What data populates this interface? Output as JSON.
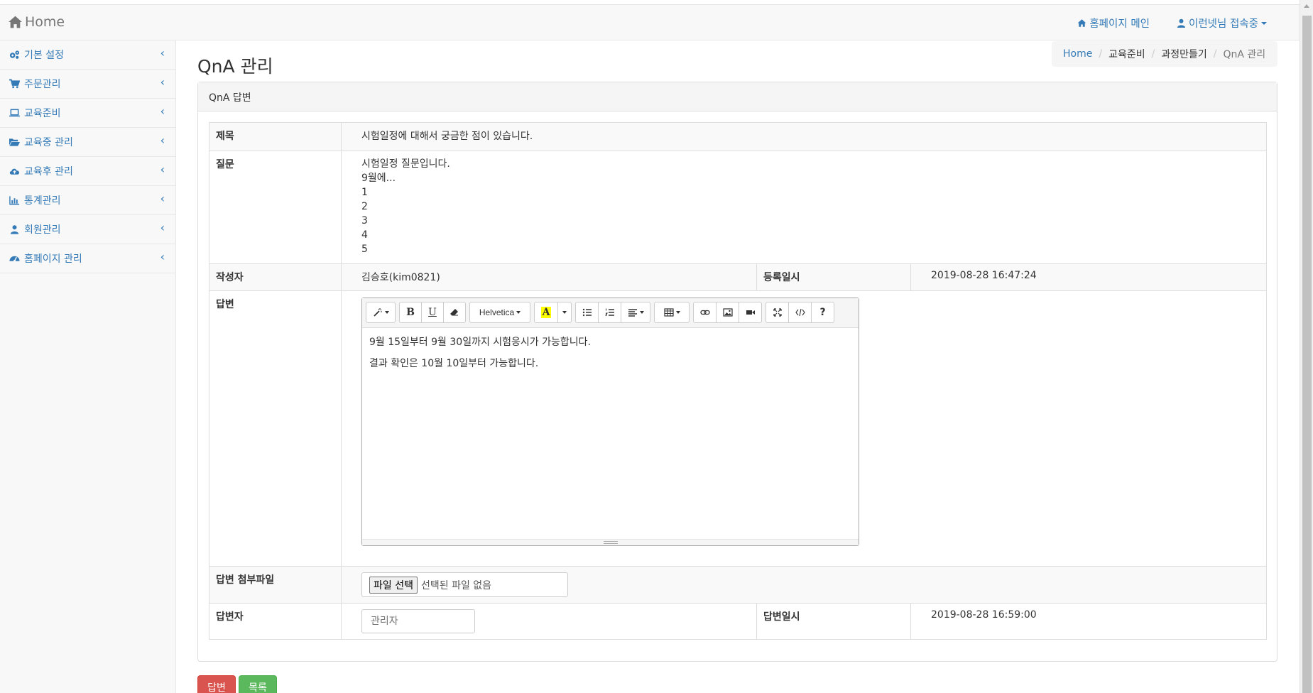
{
  "navbar": {
    "brand": "Home",
    "links": [
      {
        "label": "홈페이지 메인",
        "icon": "home-icon"
      },
      {
        "label": "이런넷님 접속중",
        "icon": "user-icon"
      }
    ]
  },
  "sidebar": {
    "items": [
      {
        "label": "기본 설정",
        "icon": "gears-icon"
      },
      {
        "label": "주문관리",
        "icon": "cart-icon"
      },
      {
        "label": "교육준비",
        "icon": "laptop-icon"
      },
      {
        "label": "교육중 관리",
        "icon": "folder-open-icon"
      },
      {
        "label": "교육후 관리",
        "icon": "cloud-upload-icon"
      },
      {
        "label": "통계관리",
        "icon": "bar-chart-icon"
      },
      {
        "label": "회원관리",
        "icon": "user-icon"
      },
      {
        "label": "홈페이지 관리",
        "icon": "dashboard-icon"
      }
    ]
  },
  "page": {
    "title": "QnA 관리"
  },
  "breadcrumb": [
    "Home",
    "교육준비",
    "과정만들기",
    "QnA 관리"
  ],
  "panel": {
    "heading": "QnA 답변"
  },
  "form": {
    "subject_label": "제목",
    "subject": "시험일정에 대해서 궁금한 점이 있습니다.",
    "question_label": "질문",
    "question_lines": [
      "시험일정 질문입니다.",
      "9월에...",
      "1",
      "2",
      "3",
      "4",
      "5"
    ],
    "author_label": "작성자",
    "author": "김승호(kim0821)",
    "reg_date_label": "등록일시",
    "reg_date": "2019-08-28 16:47:24",
    "answer_label": "답변",
    "answer_lines": [
      "9월 15일부터 9월 30일까지 시험응시가 가능합니다.",
      "결과 확인은 10월 10일부터 가능합니다."
    ],
    "font_select": "Helvetica",
    "attach_label": "답변 첨부파일",
    "file_button": "파일 선택",
    "file_status": "선택된 파일 없음",
    "answerer_label": "답변자",
    "answerer_placeholder": "관리자",
    "answer_date_label": "답변일시",
    "answer_date": "2019-08-28 16:59:00"
  },
  "buttons": {
    "answer": "답변",
    "list": "목록"
  },
  "colors": {
    "link": "#337ab7",
    "danger": "#d9534f",
    "success": "#5cb85c"
  }
}
